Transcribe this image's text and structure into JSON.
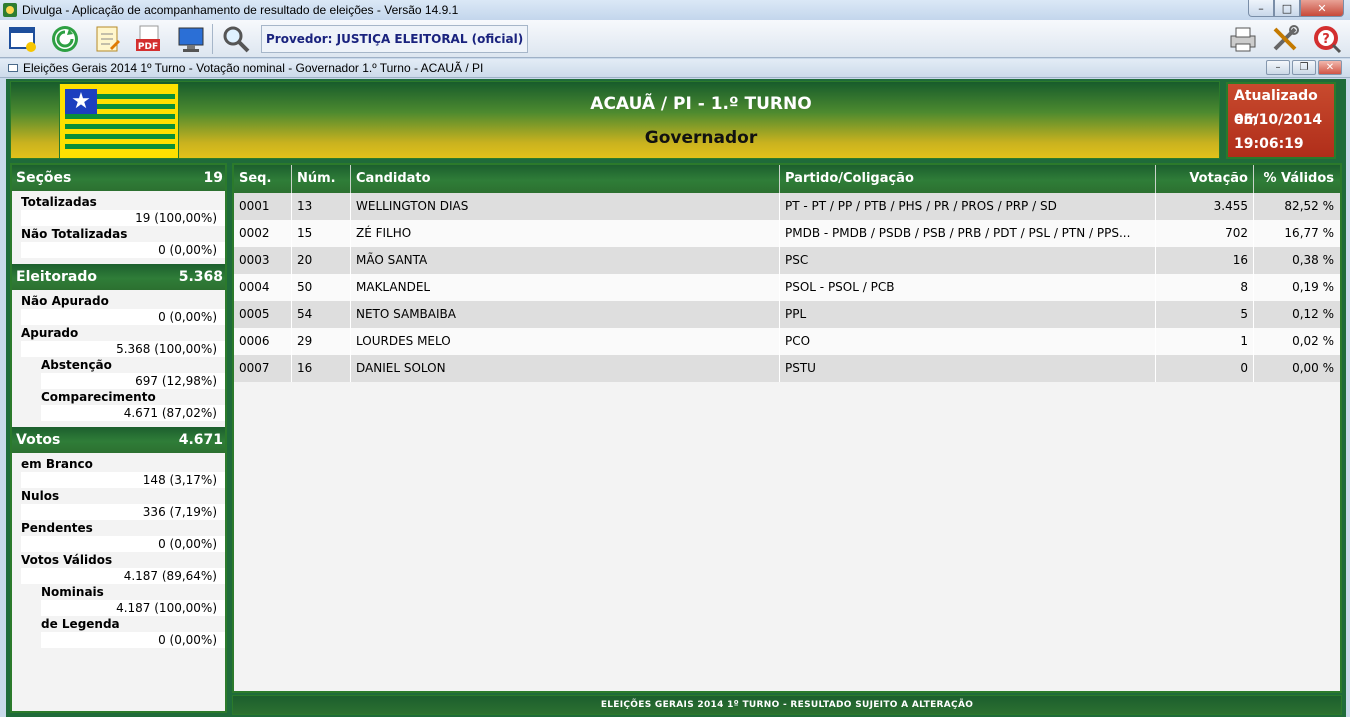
{
  "window": {
    "title": "Divulga - Aplicação de acompanhamento de resultado de eleições - Versão 14.9.1",
    "min": "–",
    "max": "□",
    "close": "✕"
  },
  "toolbar": {
    "provider": "Provedor: JUSTIÇA ELEITORAL (oficial)",
    "pdf_label": "PDF"
  },
  "child_window": {
    "title": "Eleições Gerais 2014 1º Turno - Votação nominal - Governador 1.º Turno - ACAUÃ / PI",
    "min": "–",
    "restore": "❐",
    "close": "✕"
  },
  "header": {
    "location": "ACAUÃ / PI - 1.º TURNO",
    "office": "Governador",
    "updated_label": "Atualizado em",
    "updated_date": "05/10/2014",
    "updated_time": "19:06:19"
  },
  "summary": {
    "secoes": {
      "title": "Seções",
      "total": "19",
      "totalizadas_label": "Totalizadas",
      "totalizadas": "19 (100,00%)",
      "nao_totalizadas_label": "Não Totalizadas",
      "nao_totalizadas": "0 (0,00%)"
    },
    "eleitorado": {
      "title": "Eleitorado",
      "total": "5.368",
      "nao_apurado_label": "Não Apurado",
      "nao_apurado": "0 (0,00%)",
      "apurado_label": "Apurado",
      "apurado": "5.368 (100,00%)",
      "abstencao_label": "Abstenção",
      "abstencao": "697 (12,98%)",
      "comparecimento_label": "Comparecimento",
      "comparecimento": "4.671 (87,02%)"
    },
    "votos": {
      "title": "Votos",
      "total": "4.671",
      "branco_label": "em Branco",
      "branco": "148 (3,17%)",
      "nulos_label": "Nulos",
      "nulos": "336 (7,19%)",
      "pendentes_label": "Pendentes",
      "pendentes": "0 (0,00%)",
      "validos_label": "Votos Válidos",
      "validos": "4.187 (89,64%)",
      "nominais_label": "Nominais",
      "nominais": "4.187 (100,00%)",
      "legenda_label": "de Legenda",
      "legenda": "0 (0,00%)"
    }
  },
  "table": {
    "columns": [
      "Seq.",
      "Núm.",
      "Candidato",
      "Partido/Coligação",
      "Votação",
      "% Válidos"
    ],
    "rows": [
      [
        "0001",
        "13",
        "WELLINGTON DIAS",
        "PT - PT / PP / PTB / PHS / PR / PROS / PRP / SD",
        "3.455",
        "82,52 %"
      ],
      [
        "0002",
        "15",
        "ZÉ FILHO",
        "PMDB - PMDB / PSDB / PSB / PRB / PDT / PSL / PTN / PPS...",
        "702",
        "16,77 %"
      ],
      [
        "0003",
        "20",
        "MÃO SANTA",
        "PSC",
        "16",
        "0,38 %"
      ],
      [
        "0004",
        "50",
        "MAKLANDEL",
        "PSOL - PSOL / PCB",
        "8",
        "0,19 %"
      ],
      [
        "0005",
        "54",
        "NETO SAMBAIBA",
        "PPL",
        "5",
        "0,12 %"
      ],
      [
        "0006",
        "29",
        "LOURDES MELO",
        "PCO",
        "1",
        "0,02 %"
      ],
      [
        "0007",
        "16",
        "DANIEL SOLON",
        "PSTU",
        "0",
        "0,00 %"
      ]
    ]
  },
  "footer": "ELEIÇÕES GERAIS 2014 1º TURNO - RESULTADO SUJEITO A ALTERAÇÃO",
  "icons": [
    "new-window-icon",
    "refresh-icon",
    "notes-icon",
    "pdf-icon",
    "monitor-icon",
    "search-icon",
    "printer-icon",
    "tools-icon",
    "help-icon",
    "star-icon"
  ],
  "colors": {
    "accent_green": "#1f6b3a",
    "header_yellow": "#e3c11a",
    "updated_red": "#b02e1a"
  }
}
